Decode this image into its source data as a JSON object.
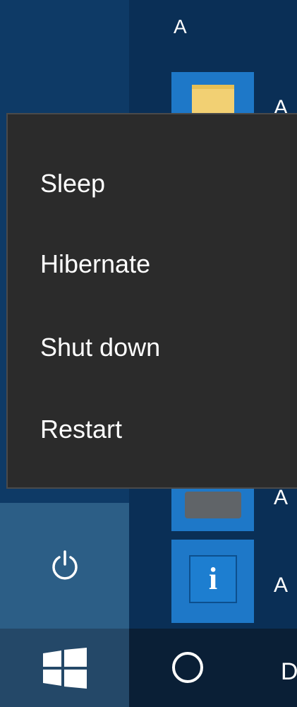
{
  "start_menu": {
    "group_letter": "A",
    "app_labels": [
      "A",
      "A",
      "A"
    ]
  },
  "power_menu": {
    "items": [
      {
        "label": "Sleep"
      },
      {
        "label": "Hibernate"
      },
      {
        "label": "Shut down"
      },
      {
        "label": "Restart"
      }
    ]
  },
  "icons": {
    "power": "power-icon",
    "start": "windows-logo-icon",
    "cortana": "cortana-circle-icon",
    "folder": "folder-icon",
    "info": "info-icon"
  },
  "info_tile_glyph": "i",
  "taskbar": {
    "edge_text": "D"
  },
  "colors": {
    "menu_background": "#2b2b2b",
    "tile_blue": "#1e78c8",
    "start_background": "#0e3a66",
    "taskbar": "#0a1f36"
  }
}
